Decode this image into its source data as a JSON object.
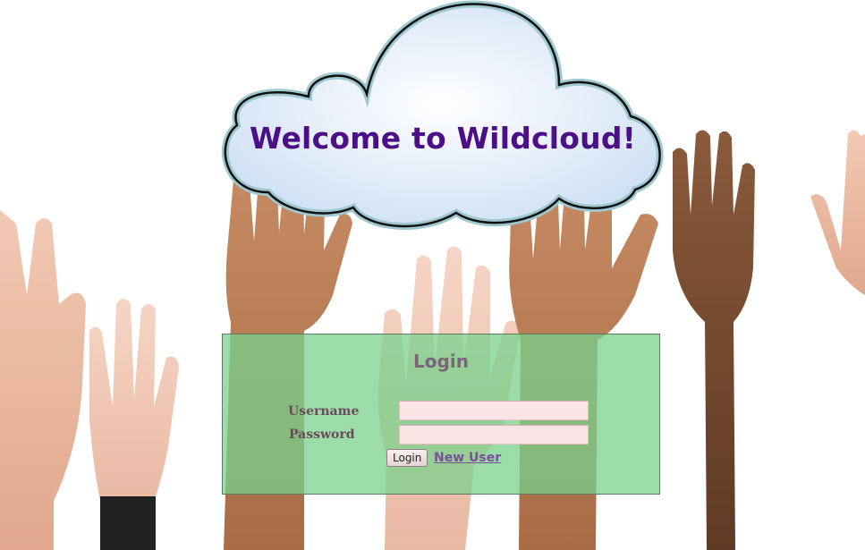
{
  "header": {
    "title": "Welcome to Wildcloud!"
  },
  "login": {
    "heading": "Login",
    "username_label": "Username",
    "password_label": "Password",
    "username_value": "",
    "password_value": "",
    "login_button": "Login",
    "new_user_link": "New User"
  },
  "colors": {
    "title": "#4b0f86",
    "panel": "#78d28c",
    "input_bg": "#fbe4e6",
    "link": "#7b4f9c"
  }
}
